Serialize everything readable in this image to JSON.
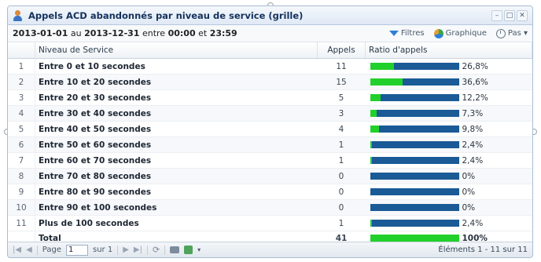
{
  "window": {
    "title": "Appels ACD abandonnés par niveau de service (grille)",
    "controls": [
      "–",
      "□",
      "✕"
    ]
  },
  "toolbar": {
    "date_from": "2013-01-01",
    "au": "au",
    "date_to": "2013-12-31",
    "entre": "entre",
    "time_from": "00:00",
    "et": "et",
    "time_to": "23:59",
    "filter_label": "Filtres",
    "chart_label": "Graphique",
    "step_label": "Pas ▾"
  },
  "table": {
    "headers": [
      "",
      "Niveau de Service",
      "Appels",
      "Ratio d'appels"
    ],
    "rows": [
      {
        "num": "1",
        "level": "Entre 0 et 10 secondes",
        "calls": "11",
        "ratio": 0.268,
        "pct": "26,8%"
      },
      {
        "num": "2",
        "level": "Entre 10 et 20 secondes",
        "calls": "15",
        "ratio": 0.366,
        "pct": "36,6%"
      },
      {
        "num": "3",
        "level": "Entre 20 et 30 secondes",
        "calls": "5",
        "ratio": 0.122,
        "pct": "12,2%"
      },
      {
        "num": "4",
        "level": "Entre 30 et 40 secondes",
        "calls": "3",
        "ratio": 0.073,
        "pct": "7,3%"
      },
      {
        "num": "5",
        "level": "Entre 40 et 50 secondes",
        "calls": "4",
        "ratio": 0.098,
        "pct": "9,8%"
      },
      {
        "num": "6",
        "level": "Entre 50 et 60 secondes",
        "calls": "1",
        "ratio": 0.024,
        "pct": "2,4%"
      },
      {
        "num": "7",
        "level": "Entre 60 et 70 secondes",
        "calls": "1",
        "ratio": 0.024,
        "pct": "2,4%"
      },
      {
        "num": "8",
        "level": "Entre 70 et 80 secondes",
        "calls": "0",
        "ratio": 0,
        "pct": "0%"
      },
      {
        "num": "9",
        "level": "Entre 80 et 90 secondes",
        "calls": "0",
        "ratio": 0,
        "pct": "0%"
      },
      {
        "num": "10",
        "level": "Entre 90 et 100 secondes",
        "calls": "0",
        "ratio": 0,
        "pct": "0%"
      },
      {
        "num": "11",
        "level": "Plus de 100 secondes",
        "calls": "1",
        "ratio": 0.024,
        "pct": "2,4%"
      }
    ],
    "total": {
      "label": "Total",
      "calls": "41",
      "ratio": 1.0,
      "pct": "100%"
    }
  },
  "pager": {
    "page_label": "Page",
    "page_value": "1",
    "of_label": "sur 1",
    "items_label": "Éléments 1 - 11 sur 11"
  },
  "colors": {
    "bar_fill": "#22d02b",
    "bar_track": "#1a5a96"
  }
}
